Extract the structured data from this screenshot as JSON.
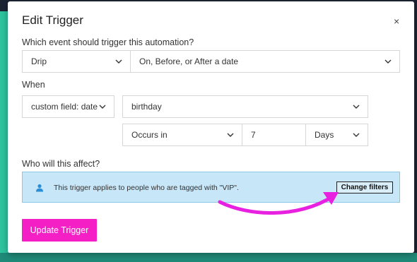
{
  "dialog": {
    "title": "Edit Trigger",
    "close_glyph": "×"
  },
  "event": {
    "question": "Which event should trigger this automation?",
    "source_value": "Drip",
    "event_value": "On, Before, or After a date"
  },
  "when": {
    "label": "When",
    "field_type_value": "custom field: date",
    "field_value": "birthday",
    "timing_value": "Occurs in",
    "amount_value": "7",
    "unit_value": "Days"
  },
  "affect": {
    "question": "Who will this affect?",
    "info_text": "This trigger applies to people who are tagged with \"VIP\".",
    "change_filters_label": "Change filters",
    "icon": "person-icon"
  },
  "footer": {
    "update_label": "Update Trigger"
  },
  "colors": {
    "accent": "#f51fc6",
    "info_bg": "#c7e6f7",
    "arrow": "#e820e0",
    "teal": "#2ec4a0"
  }
}
